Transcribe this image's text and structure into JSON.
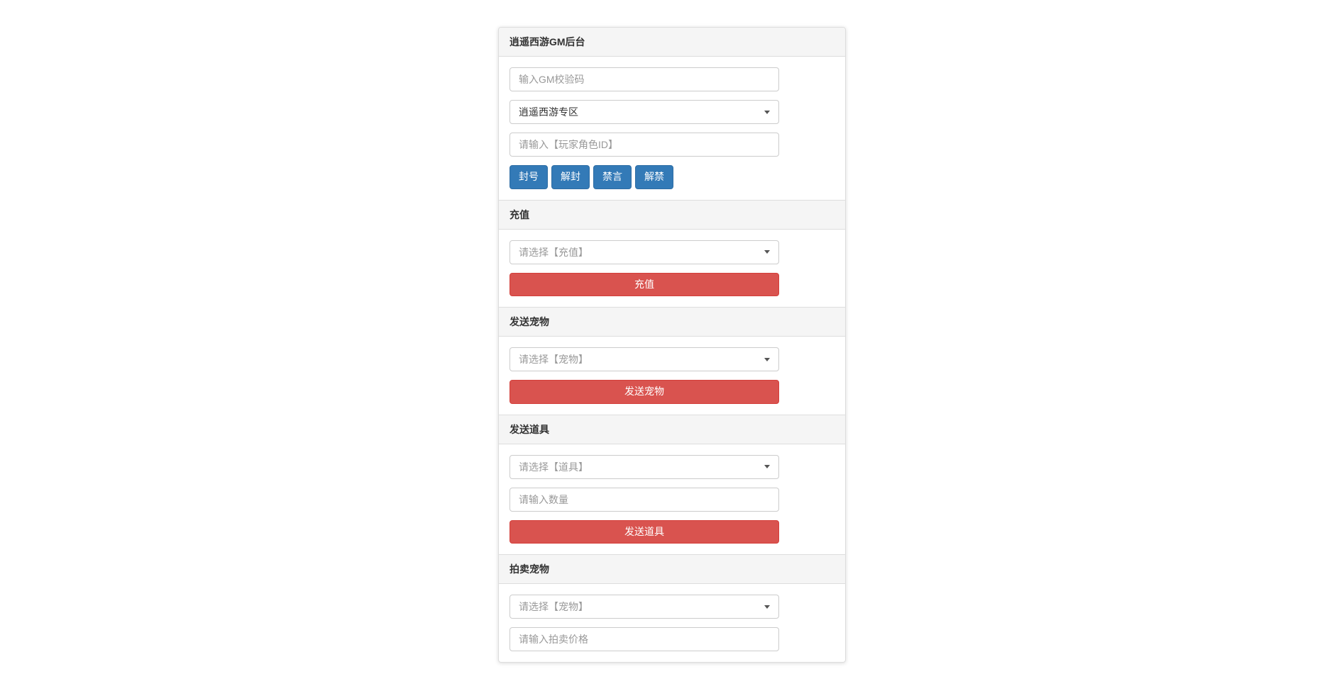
{
  "panel": {
    "title": "逍遥西游GM后台"
  },
  "topForm": {
    "gmCodePlaceholder": "输入GM校验码",
    "serverSelected": "逍遥西游专区",
    "playerIdPlaceholder": "请输入【玩家角色ID】",
    "buttons": {
      "ban": "封号",
      "unban": "解封",
      "mute": "禁言",
      "unmute": "解禁"
    }
  },
  "sections": {
    "recharge": {
      "title": "充值",
      "selectPlaceholder": "请选择【充值】",
      "button": "充值"
    },
    "sendPet": {
      "title": "发送宠物",
      "selectPlaceholder": "请选择【宠物】",
      "button": "发送宠物"
    },
    "sendItem": {
      "title": "发送道具",
      "selectPlaceholder": "请选择【道具】",
      "qtyPlaceholder": "请输入数量",
      "button": "发送道具"
    },
    "auctionPet": {
      "title": "拍卖宠物",
      "selectPlaceholder": "请选择【宠物】",
      "pricePlaceholder": "请输入拍卖价格"
    }
  }
}
